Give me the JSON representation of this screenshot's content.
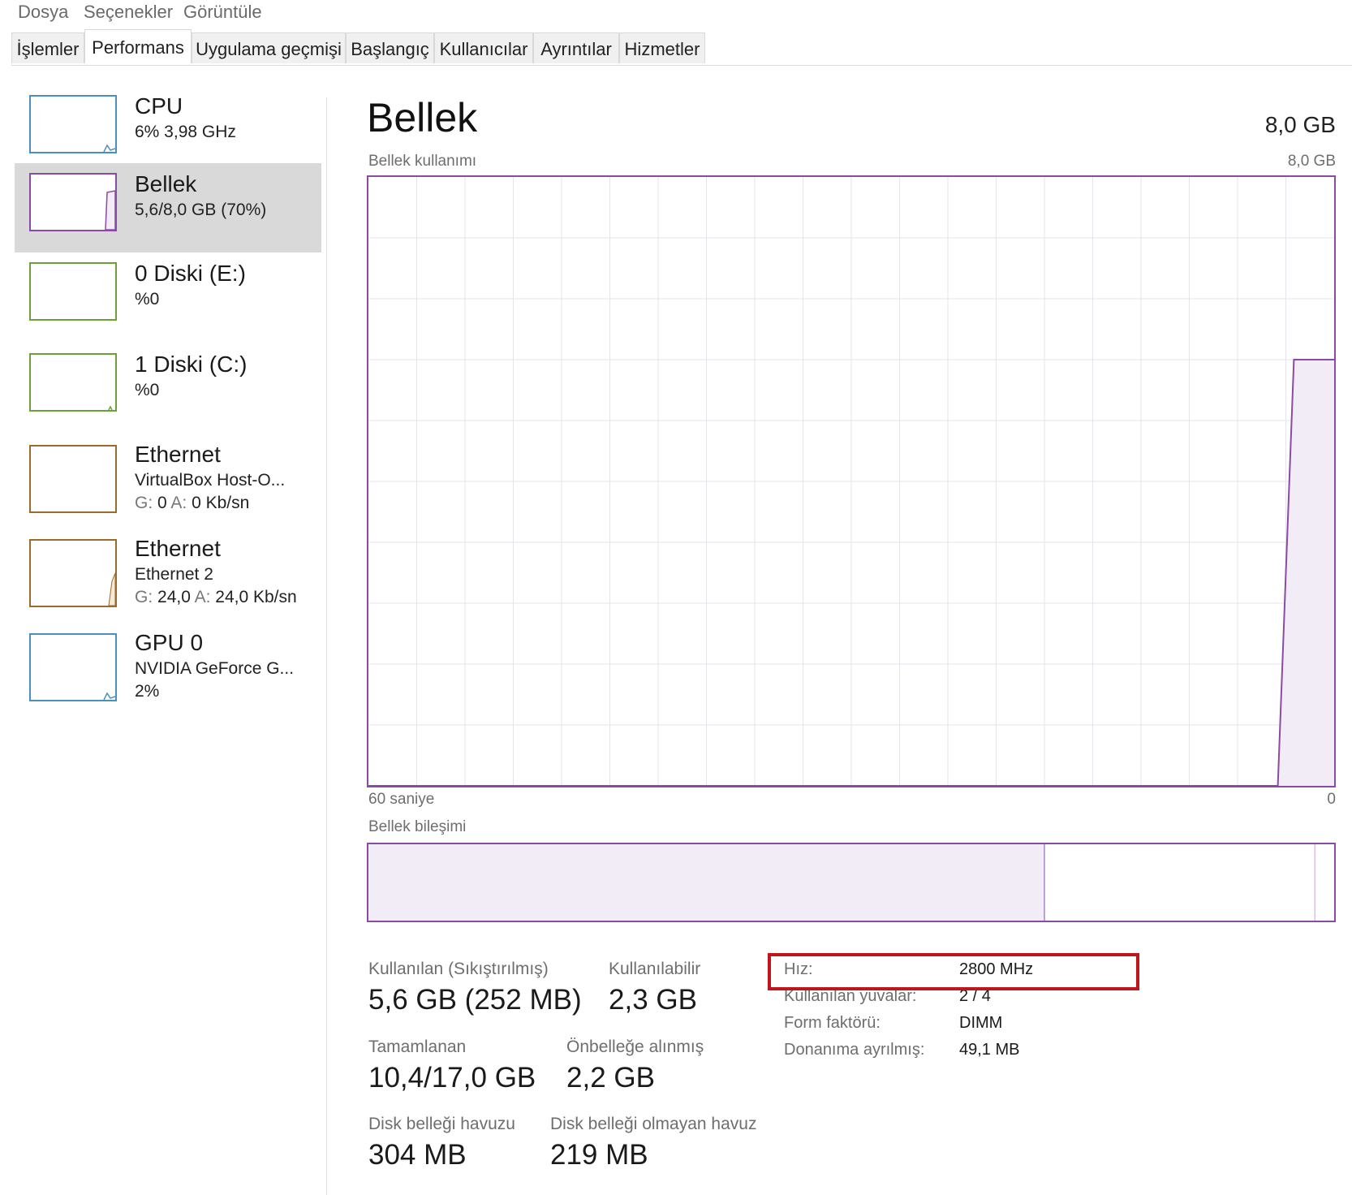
{
  "menu": {
    "items": [
      "Dosya",
      "Seçenekler",
      "Görüntüle"
    ]
  },
  "tabs": {
    "items": [
      "İşlemler",
      "Performans",
      "Uygulama geçmişi",
      "Başlangıç",
      "Kullanıcılar",
      "Ayrıntılar",
      "Hizmetler"
    ],
    "active": "Performans"
  },
  "sidebar": {
    "items": [
      {
        "title": "CPU",
        "line1": "6% 3,98 GHz",
        "line2": "",
        "color": "#4a8fc0",
        "usage_fraction": 0.06
      },
      {
        "title": "Bellek",
        "line1": "5,6/8,0 GB (70%)",
        "line2": "",
        "color": "#8b4aa6",
        "usage_fraction": 0.7
      },
      {
        "title": "0 Diski (E:)",
        "line1": "%0",
        "line2": "",
        "color": "#6aa13a",
        "usage_fraction": 0
      },
      {
        "title": "1 Diski (C:)",
        "line1": "%0",
        "line2": "",
        "color": "#6aa13a",
        "usage_fraction": 0
      },
      {
        "title": "Ethernet",
        "line1": "VirtualBox Host-O...",
        "line2_g": "G:",
        "line2_gv": "0",
        "line2_a": "A:",
        "line2_av": "0 Kb/sn",
        "color": "#9a6b2a"
      },
      {
        "title": "Ethernet",
        "line1": "Ethernet 2",
        "line2_g": "G:",
        "line2_gv": "24,0",
        "line2_a": "A:",
        "line2_av": "24,0 Kb/sn",
        "color": "#9a6b2a"
      },
      {
        "title": "GPU 0",
        "line1": "NVIDIA GeForce G...",
        "line2": "2%",
        "color": "#4a8fc0",
        "usage_fraction": 0.02
      }
    ]
  },
  "main": {
    "title": "Bellek",
    "total": "8,0 GB",
    "usage_chart": {
      "label": "Bellek kullanımı",
      "max_label": "8,0 GB",
      "x_left_label": "60 saniye",
      "x_right_label": "0"
    },
    "composition": {
      "label": "Bellek bileşimi",
      "in_use_fraction": 0.7,
      "modified_fraction": 0.0,
      "standby_fraction": 0.28
    },
    "stats": {
      "in_use_label": "Kullanılan (Sıkıştırılmış)",
      "in_use_value": "5,6 GB (252 MB)",
      "available_label": "Kullanılabilir",
      "available_value": "2,3 GB",
      "committed_label": "Tamamlanan",
      "committed_value": "10,4/17,0 GB",
      "cached_label": "Önbelleğe alınmış",
      "cached_value": "2,2 GB",
      "paged_label": "Disk belleği havuzu",
      "paged_value": "304 MB",
      "nonpaged_label": "Disk belleği olmayan havuz",
      "nonpaged_value": "219 MB"
    },
    "properties": [
      {
        "key": "Hız:",
        "value": "2800 MHz"
      },
      {
        "key": "Kullanılan yuvalar:",
        "value": "2 / 4"
      },
      {
        "key": "Form faktörü:",
        "value": "DIMM"
      },
      {
        "key": "Donanıma ayrılmış:",
        "value": "49,1 MB"
      }
    ]
  },
  "colors": {
    "memory_accent": "#8b4aa6",
    "memory_fill": "#f1ecf5",
    "grid": "#e8e2ec",
    "highlight": "#c0161b"
  },
  "chart_data": {
    "type": "area",
    "title": "Bellek kullanımı",
    "xlabel": "",
    "ylabel": "",
    "x": [
      60,
      3.5,
      2.5,
      0
    ],
    "values": [
      0,
      0,
      5.6,
      5.6
    ],
    "x_unit": "saniye",
    "xlim": [
      60,
      0
    ],
    "ylim": [
      0,
      8
    ],
    "y_unit": "GB",
    "grid": true,
    "legend": "none"
  }
}
